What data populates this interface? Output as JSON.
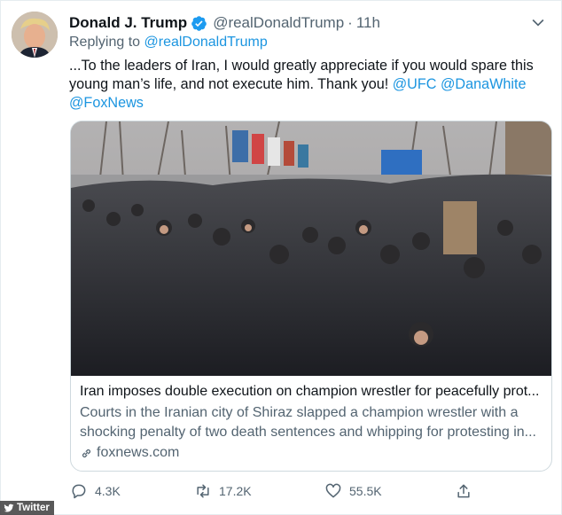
{
  "tweet": {
    "author_name": "Donald J. Trump",
    "author_handle": "@realDonaldTrump",
    "separator": "·",
    "time_ago": "11h",
    "replying_prefix": "Replying to",
    "replying_handle": "@realDonaldTrump",
    "body_text": "...To the leaders of Iran, I would greatly appreciate if you would spare this young man’s life, and not execute him. Thank you!",
    "mentions": [
      "@UFC",
      "@DanaWhite",
      "@FoxNews"
    ],
    "icons": {
      "verified": "verified-badge-icon",
      "more": "chevron-down-icon"
    }
  },
  "card": {
    "image_alt_icon": "crowd-photo",
    "title": "Iran imposes double execution on champion wrestler for peacefully prot...",
    "description": "Courts in the Iranian city of Shiraz slapped a champion wrestler with a shocking penalty of two death sentences and whipping for protesting in...",
    "domain": "foxnews.com",
    "domain_icon": "link-icon"
  },
  "actions": {
    "reply_count": "4.3K",
    "retweet_count": "17.2K",
    "like_count": "55.5K",
    "reply_icon": "reply-icon",
    "retweet_icon": "retweet-icon",
    "like_icon": "heart-icon",
    "share_icon": "share-icon"
  },
  "watermark": {
    "label": "Twitter",
    "icon": "twitter-bird-icon"
  },
  "colors": {
    "link": "#1b95e0",
    "secondary_text": "#536471",
    "primary_text": "#0f1419",
    "border": "#cfd9de"
  }
}
